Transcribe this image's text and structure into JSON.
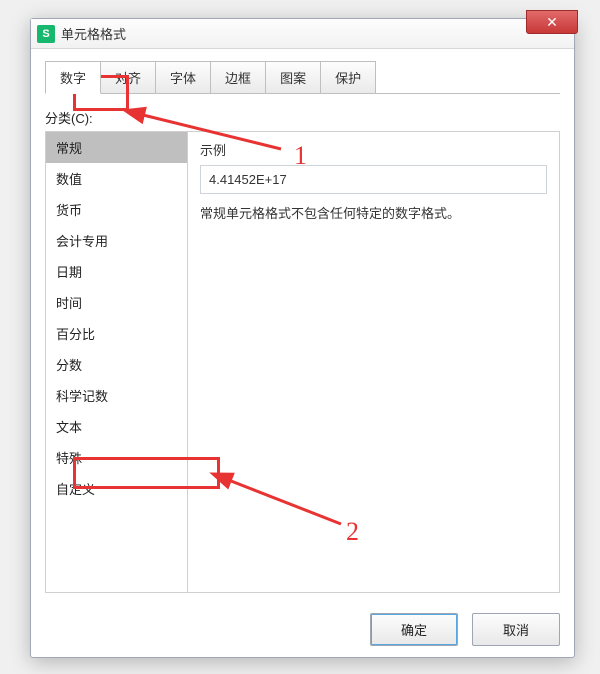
{
  "window": {
    "title": "单元格格式",
    "app_icon_letter": "S"
  },
  "tabs": [
    "数字",
    "对齐",
    "字体",
    "边框",
    "图案",
    "保护"
  ],
  "active_tab_index": 0,
  "category_label": "分类(C):",
  "categories": [
    "常规",
    "数值",
    "货币",
    "会计专用",
    "日期",
    "时间",
    "百分比",
    "分数",
    "科学记数",
    "文本",
    "特殊",
    "自定义"
  ],
  "selected_category_index": 0,
  "example": {
    "label": "示例",
    "value": "4.41452E+17"
  },
  "description": "常规单元格格式不包含任何特定的数字格式。",
  "buttons": {
    "ok": "确定",
    "cancel": "取消"
  },
  "annotations": {
    "marker1": "1",
    "marker2": "2"
  }
}
